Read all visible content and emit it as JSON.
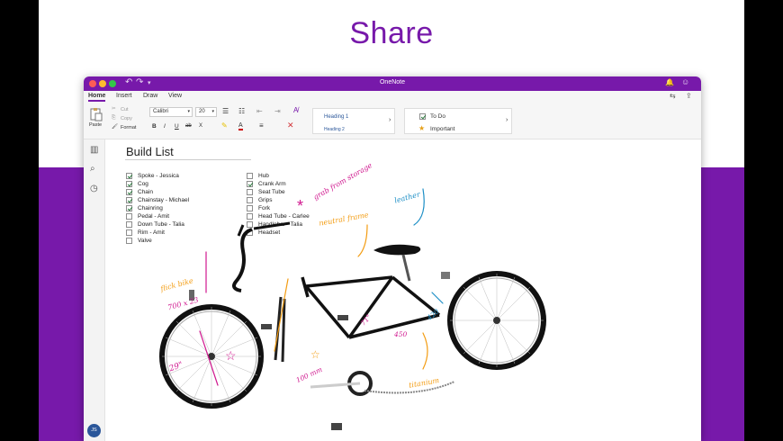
{
  "hero": {
    "title": "Share"
  },
  "window": {
    "title": "OneNote"
  },
  "tabs": [
    {
      "label": "Home",
      "active": true
    },
    {
      "label": "Insert",
      "active": false
    },
    {
      "label": "Draw",
      "active": false
    },
    {
      "label": "View",
      "active": false
    }
  ],
  "ribbon": {
    "paste": "Paste",
    "cut": "Cut",
    "copy": "Copy",
    "format": "Format",
    "font": "Calibri",
    "size": "20",
    "bold": "B",
    "italic": "I",
    "underline": "U",
    "strike": "ab",
    "sub": "X",
    "font_color_glyph": "A",
    "styles": {
      "heading1": "Heading 1",
      "heading2": "Heading 2"
    },
    "tags": {
      "todo": "To Do",
      "important": "Important"
    }
  },
  "page": {
    "title": "Build List",
    "left_items": [
      {
        "label": "Spoke - Jessica",
        "checked": true
      },
      {
        "label": "Cog",
        "checked": true
      },
      {
        "label": "Chain",
        "checked": true
      },
      {
        "label": "Chainstay - Michael",
        "checked": true
      },
      {
        "label": "Chainring",
        "checked": true
      },
      {
        "label": "Pedal - Amit",
        "checked": false
      },
      {
        "label": "Down Tube - Talia",
        "checked": false
      },
      {
        "label": "Rim - Amit",
        "checked": false
      },
      {
        "label": "Valve",
        "checked": false
      }
    ],
    "right_items": [
      {
        "label": "Hub",
        "checked": false
      },
      {
        "label": "Crank Arm",
        "checked": true
      },
      {
        "label": "Seat Tube",
        "checked": false
      },
      {
        "label": "Grips",
        "checked": false
      },
      {
        "label": "Fork",
        "checked": false
      },
      {
        "label": "Head Tube - Carlee",
        "checked": false
      },
      {
        "label": "Handlebar - Talia",
        "checked": false
      },
      {
        "label": "Headset",
        "checked": false
      }
    ],
    "annotations": {
      "grab": "grab from storage",
      "leather": "leather",
      "neutral": "neutral frame",
      "flick": "flick bike",
      "size": "700 x 23",
      "wheel": "29\"",
      "angle": "71°",
      "len450": "450",
      "len420": "420",
      "len100": "100 mm",
      "titanium": "titanium"
    }
  },
  "user": {
    "initials": "JS"
  },
  "colors": {
    "brand": "#7719aa",
    "ink_magenta": "#d0188f",
    "ink_orange": "#f39c12",
    "ink_blue": "#1e8fc6"
  }
}
